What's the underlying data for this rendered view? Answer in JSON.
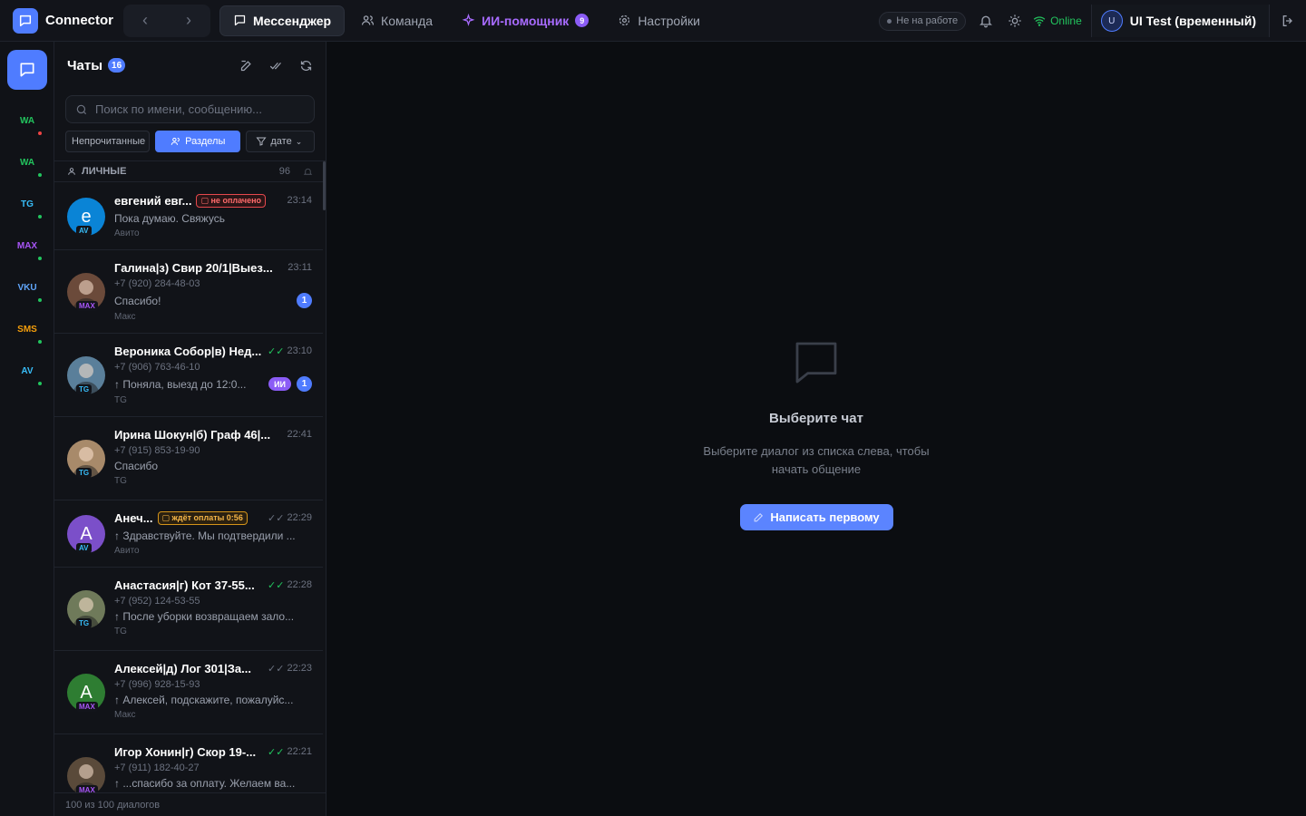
{
  "app": {
    "name": "Connector"
  },
  "tabs": [
    {
      "label": "Мессенджер",
      "icon": "chat-icon"
    },
    {
      "label": "Команда",
      "icon": "team-icon"
    },
    {
      "label": "ИИ-помощник",
      "icon": "sparkle-icon",
      "badge": "9"
    },
    {
      "label": "Настройки",
      "icon": "gear-icon"
    }
  ],
  "header": {
    "status_label": "Не на работе",
    "online_label": "Online",
    "user_initial": "U",
    "user_name": "UI Test (временный)"
  },
  "rail": [
    {
      "label": "WA",
      "color": "#22c55e",
      "dot": "#ef4444"
    },
    {
      "label": "WA",
      "color": "#22c55e",
      "dot": "#22c55e"
    },
    {
      "label": "TG",
      "color": "#38bdf8",
      "dot": "#22c55e"
    },
    {
      "label": "MAX",
      "color": "#a855f7",
      "dot": "#22c55e"
    },
    {
      "label": "VKU",
      "color": "#60a5fa",
      "dot": "#22c55e"
    },
    {
      "label": "SMS",
      "color": "#f59e0b",
      "dot": "#22c55e"
    },
    {
      "label": "AV",
      "color": "#38bdf8",
      "dot": "#22c55e"
    }
  ],
  "list": {
    "title": "Чаты",
    "count": "16",
    "search_placeholder": "Поиск по имени, сообщению...",
    "filters": {
      "unread": "Непрочитанные",
      "sections": "Разделы",
      "sort": "дате"
    },
    "section": {
      "label": "ЛИЧНЫЕ",
      "count": "96"
    },
    "footer": "100 из 100 диалогов",
    "chats": [
      {
        "name": "евгений евг...",
        "tag": "не оплачено",
        "tag_type": "red",
        "time": "23:14",
        "check": "",
        "phone": "",
        "msg": "Пока думаю. Свяжусь",
        "source": "Авито",
        "avatar": "e",
        "avatar_color": "#0a84d6",
        "src_tag": "AV",
        "src_color": "#38bdf8",
        "unread": "",
        "ai": ""
      },
      {
        "name": "Галина|з) Свир 20/1|Выез...",
        "tag": "",
        "tag_type": "",
        "time": "23:11",
        "check": "",
        "phone": "+7 (920) 284-48-03",
        "msg": "Спасибо!",
        "source": "Макс",
        "avatar": "",
        "avatar_color": "#6b4a3a",
        "src_tag": "MAX",
        "src_color": "#a855f7",
        "unread": "1",
        "ai": ""
      },
      {
        "name": "Вероника Собор|в) Нед...",
        "tag": "",
        "tag_type": "",
        "time": "23:10",
        "check": "green",
        "phone": "+7 (906) 763-46-10",
        "msg": "↑ Поняла, выезд до 12:0...",
        "source": "TG",
        "avatar": "",
        "avatar_color": "#5a7f9a",
        "src_tag": "TG",
        "src_color": "#38bdf8",
        "unread": "1",
        "ai": "ИИ"
      },
      {
        "name": "Ирина Шокун|б) Граф 46|...",
        "tag": "",
        "tag_type": "",
        "time": "22:41",
        "check": "",
        "phone": "+7 (915) 853-19-90",
        "msg": "Спасибо",
        "source": "TG",
        "avatar": "",
        "avatar_color": "#a88a6a",
        "src_tag": "TG",
        "src_color": "#38bdf8",
        "unread": "",
        "ai": ""
      },
      {
        "name": "Анеч...",
        "tag": "ждёт оплаты 0:56",
        "tag_type": "amber",
        "time": "22:29",
        "check": "gray",
        "phone": "",
        "msg": "↑ Здравствуйте. Мы подтвердили ...",
        "source": "Авито",
        "avatar": "A",
        "avatar_color": "#7b4fc9",
        "src_tag": "AV",
        "src_color": "#38bdf8",
        "unread": "",
        "ai": ""
      },
      {
        "name": "Анастасия|г) Кот 37-55...",
        "tag": "",
        "tag_type": "",
        "time": "22:28",
        "check": "green",
        "phone": "+7 (952) 124-53-55",
        "msg": "↑ После уборки возвращаем зало...",
        "source": "TG",
        "avatar": "",
        "avatar_color": "#6f7a5a",
        "src_tag": "TG",
        "src_color": "#38bdf8",
        "unread": "",
        "ai": ""
      },
      {
        "name": "Алексей|д) Лог 301|За...",
        "tag": "",
        "tag_type": "",
        "time": "22:23",
        "check": "gray",
        "phone": "+7 (996) 928-15-93",
        "msg": "↑ Алексей, подскажите, пожалуйс...",
        "source": "Макс",
        "avatar": "A",
        "avatar_color": "#2e7d32",
        "src_tag": "MAX",
        "src_color": "#a855f7",
        "unread": "",
        "ai": ""
      },
      {
        "name": "Игор Хонин|г) Скор 19-...",
        "tag": "",
        "tag_type": "",
        "time": "22:21",
        "check": "green",
        "phone": "+7 (911) 182-40-27",
        "msg": "↑ ...спасибо за оплату. Желаем ва...",
        "source": "",
        "avatar": "",
        "avatar_color": "#5a4a3a",
        "src_tag": "MAX",
        "src_color": "#a855f7",
        "unread": "",
        "ai": ""
      }
    ]
  },
  "main": {
    "empty_title": "Выберите чат",
    "empty_sub": "Выберите диалог из списка слева, чтобы начать общение",
    "write_button": "Написать первому"
  }
}
